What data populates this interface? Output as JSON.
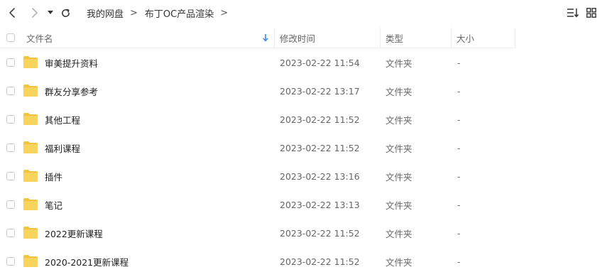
{
  "breadcrumb": [
    "我的网盘",
    "布丁OC产品渲染"
  ],
  "breadcrumb_sep": ">",
  "columns": {
    "name": "文件名",
    "modified": "修改时间",
    "type": "类型",
    "size": "大小"
  },
  "rows": [
    {
      "name": "审美提升资料",
      "modified": "2023-02-22 11:54",
      "type": "文件夹",
      "size": "-"
    },
    {
      "name": "群友分享参考",
      "modified": "2023-02-22 13:17",
      "type": "文件夹",
      "size": "-"
    },
    {
      "name": "其他工程",
      "modified": "2023-02-22 11:52",
      "type": "文件夹",
      "size": "-"
    },
    {
      "name": "福利课程",
      "modified": "2023-02-22 11:52",
      "type": "文件夹",
      "size": "-"
    },
    {
      "name": "插件",
      "modified": "2023-02-22 13:16",
      "type": "文件夹",
      "size": "-"
    },
    {
      "name": "笔记",
      "modified": "2023-02-22 13:13",
      "type": "文件夹",
      "size": "-"
    },
    {
      "name": "2022更新课程",
      "modified": "2023-02-22 11:52",
      "type": "文件夹",
      "size": "-"
    },
    {
      "name": "2020-2021更新课程",
      "modified": "2023-02-22 11:52",
      "type": "文件夹",
      "size": "-"
    }
  ],
  "icons": {
    "back": "chevron-left-icon",
    "forward": "chevron-right-icon",
    "history": "caret-down-icon",
    "refresh": "refresh-icon",
    "sort": "sort-icon",
    "grid": "grid-view-icon",
    "folder": "folder-icon",
    "sort_indicator": "arrow-down-icon"
  },
  "colors": {
    "folder": "#f9d45c",
    "folder_tab": "#f2c33f",
    "sort_arrow": "#3a8ee6"
  }
}
